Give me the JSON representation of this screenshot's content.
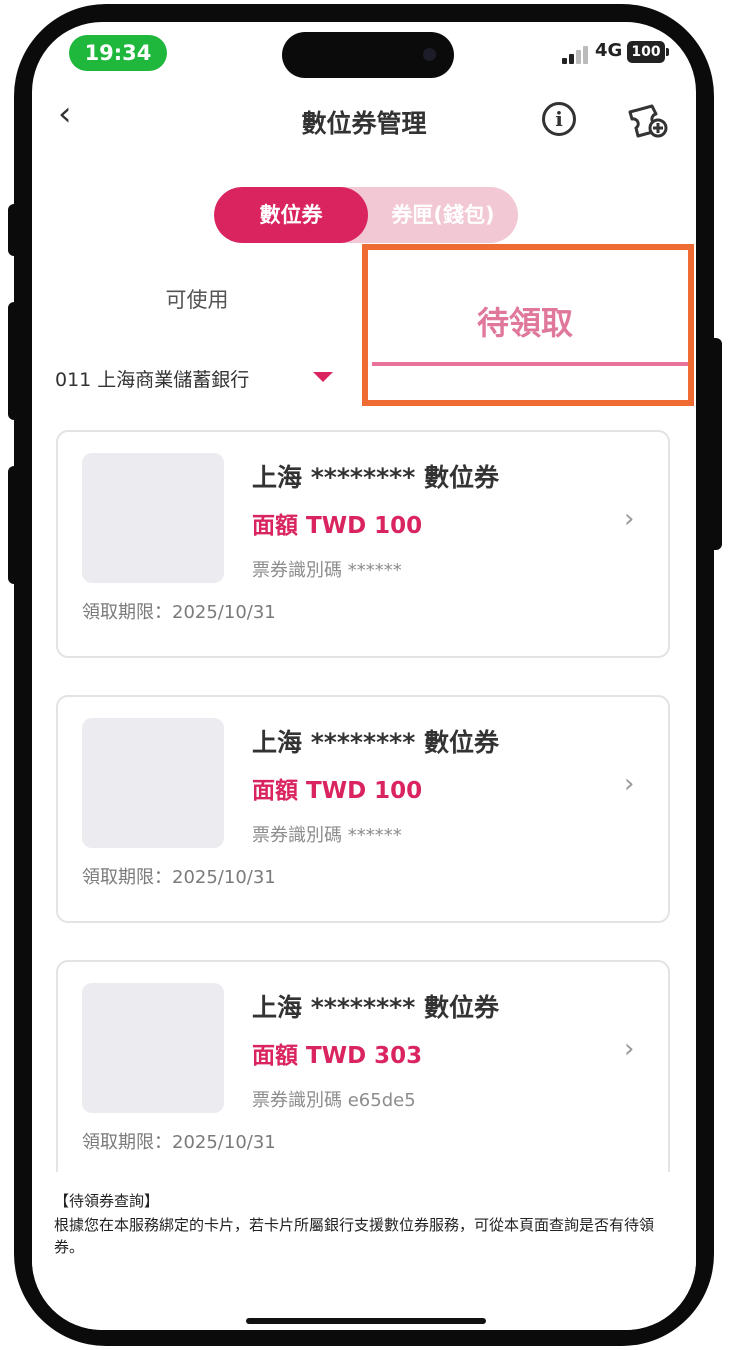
{
  "status_bar": {
    "time": "19:34",
    "network": "4G",
    "battery": "100"
  },
  "nav": {
    "back_glyph": "‹",
    "title": "數位券管理",
    "info_icon": "info-icon",
    "coupon_icon": "coupon-add-icon"
  },
  "segment": {
    "active_label": "數位券",
    "inactive_label": "券匣(錢包)"
  },
  "tabs": {
    "available": "可使用",
    "pending": "待領取"
  },
  "bank_selector": {
    "label": "011 上海商業儲蓄銀行"
  },
  "coupons": [
    {
      "title": "上海 ******** 數位券",
      "amount": "面額 TWD 100",
      "id": "票券識別碼 ******",
      "deadline": "領取期限：2025/10/31"
    },
    {
      "title": "上海 ******** 數位券",
      "amount": "面額 TWD 100",
      "id": "票券識別碼 ******",
      "deadline": "領取期限：2025/10/31"
    },
    {
      "title": "上海 ******** 數位券",
      "amount": "面額 TWD 303",
      "id": "票券識別碼 e65de5",
      "deadline": "領取期限：2025/10/31"
    }
  ],
  "notice": {
    "title": "【待領券查詢】",
    "body": "根據您在本服務綁定的卡片，若卡片所屬銀行支援數位券服務，可從本頁面查詢是否有待領券。"
  },
  "colors": {
    "accent": "#d9245f",
    "highlight": "#ee6b33",
    "status_green": "#1fb83c"
  }
}
